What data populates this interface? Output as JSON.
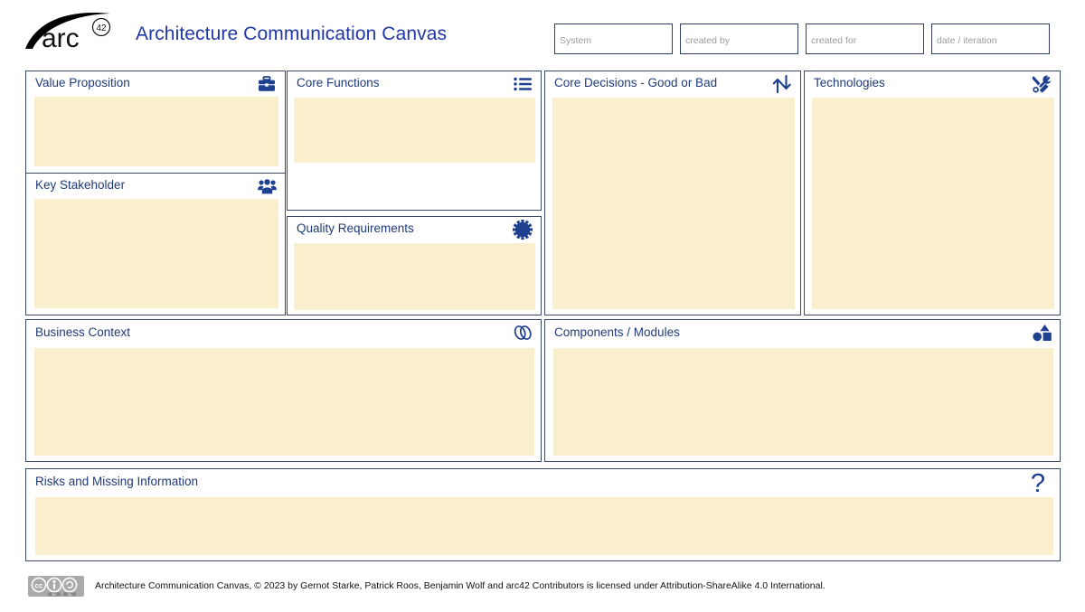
{
  "header": {
    "logo_text": "arc",
    "logo_sup": "42",
    "title": "Architecture Communication Canvas",
    "meta_fields": [
      {
        "name": "system",
        "placeholder": "System",
        "value": ""
      },
      {
        "name": "created-by",
        "placeholder": "created by",
        "value": ""
      },
      {
        "name": "created-for",
        "placeholder": "created for",
        "value": ""
      },
      {
        "name": "date-iteration",
        "placeholder": "date / iteration",
        "value": ""
      }
    ]
  },
  "panels": {
    "value_proposition": {
      "title": "Value Proposition",
      "icon": "briefcase-icon",
      "content": ""
    },
    "key_stakeholder": {
      "title": "Key Stakeholder",
      "icon": "people-group-icon",
      "content": ""
    },
    "core_functions": {
      "title": "Core Functions",
      "icon": "bulleted-list-icon",
      "content": ""
    },
    "quality_requirements": {
      "title": "Quality Requirements",
      "icon": "starburst-badge-icon",
      "content": ""
    },
    "core_decisions": {
      "title": "Core Decisions - Good or Bad",
      "icon": "up-down-arrows-icon",
      "content": ""
    },
    "technologies": {
      "title": "Technologies",
      "icon": "tools-icon",
      "content": ""
    },
    "business_context": {
      "title": "Business Context",
      "icon": "link-chain-icon",
      "content": ""
    },
    "components_modules": {
      "title": "Components / Modules",
      "icon": "shapes-icon",
      "content": ""
    },
    "risks": {
      "title": "Risks and Missing Information",
      "icon": "question-mark-icon",
      "content": ""
    }
  },
  "footer": {
    "license_text": "Architecture Communication Canvas, © 2023 by Gernot Starke, Patrick Roos, Benjamin Wolf and arc42 Contributors is licensed under Attribution-ShareAlike 4.0 International.",
    "badge": "creative-commons-by-sa-badge",
    "badge_labels": [
      "cc",
      "BY",
      "SA"
    ]
  },
  "colors": {
    "accent_blue": "#1f3f8f",
    "title_blue": "#2137a8",
    "heading_blue": "#1f3a7a",
    "panel_border": "#3b4a6b",
    "fill_cream": "#faefcd",
    "placeholder_gray": "#9b9b9b"
  }
}
